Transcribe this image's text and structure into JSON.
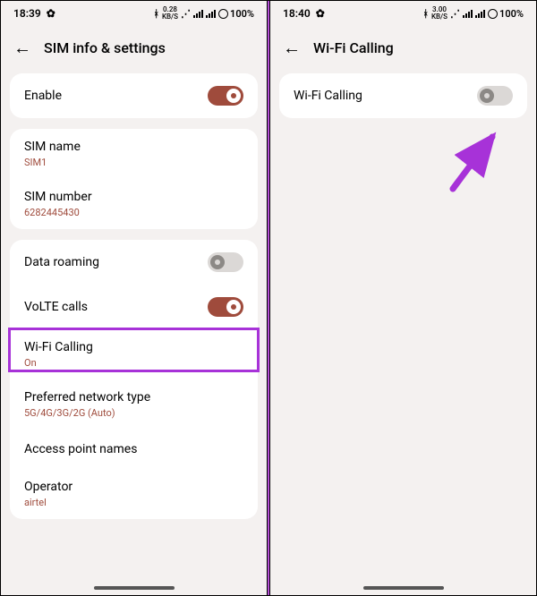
{
  "left": {
    "status": {
      "time": "18:39",
      "speed_top": "0.28",
      "speed_unit": "KB/S",
      "battery": "100%"
    },
    "header": {
      "title": "SIM info & settings"
    },
    "enable": {
      "label": "Enable"
    },
    "sim_name": {
      "label": "SIM name",
      "value": "SIM1"
    },
    "sim_number": {
      "label": "SIM number",
      "value": "6282445430"
    },
    "data_roaming": {
      "label": "Data roaming"
    },
    "volte": {
      "label": "VoLTE calls"
    },
    "wifi_calling": {
      "label": "Wi-Fi Calling",
      "value": "On"
    },
    "pref_net": {
      "label": "Preferred network type",
      "value": "5G/4G/3G/2G (Auto)"
    },
    "apn": {
      "label": "Access point names"
    },
    "operator": {
      "label": "Operator",
      "value": "airtel"
    }
  },
  "right": {
    "status": {
      "time": "18:40",
      "speed_top": "3.00",
      "speed_unit": "KB/S",
      "battery": "100%"
    },
    "header": {
      "title": "Wi-Fi Calling"
    },
    "wifi_calling": {
      "label": "Wi-Fi Calling"
    }
  }
}
